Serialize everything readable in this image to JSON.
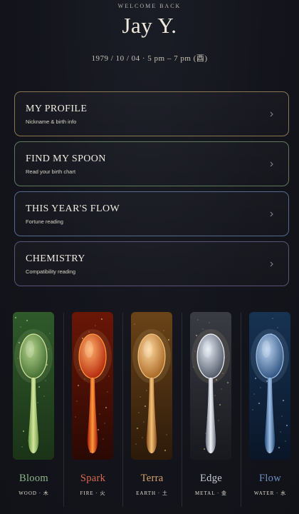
{
  "header": {
    "welcome": "WELCOME BACK",
    "name": "Jay Y.",
    "birth": "1979 / 10 / 04 · 5 pm – 7 pm (酉)"
  },
  "menu": {
    "items": [
      {
        "title": "MY PROFILE",
        "subtitle": "Nickname & birth info",
        "border": "#8a7752"
      },
      {
        "title": "FIND MY SPOON",
        "subtitle": "Read your birth chart",
        "border": "#5f7a5a"
      },
      {
        "title": "THIS YEAR'S FLOW",
        "subtitle": "Fortune reading",
        "border": "#56698e"
      },
      {
        "title": "CHEMISTRY",
        "subtitle": "Compatibility reading",
        "border": "#5d5277"
      }
    ],
    "chevron_icon": "chevron-right-icon"
  },
  "spoons": [
    {
      "name": "Bloom",
      "element": "WOOD · 木",
      "color": "#8fb58a",
      "theme": "wood"
    },
    {
      "name": "Spark",
      "element": "FIRE · 火",
      "color": "#d9694e",
      "theme": "fire"
    },
    {
      "name": "Terra",
      "element": "EARTH · 土",
      "color": "#d8a46c",
      "theme": "earth"
    },
    {
      "name": "Edge",
      "element": "METAL · 金",
      "color": "#c8ccd4",
      "theme": "metal"
    },
    {
      "name": "Flow",
      "element": "WATER · 水",
      "color": "#6b8fc0",
      "theme": "water"
    }
  ]
}
